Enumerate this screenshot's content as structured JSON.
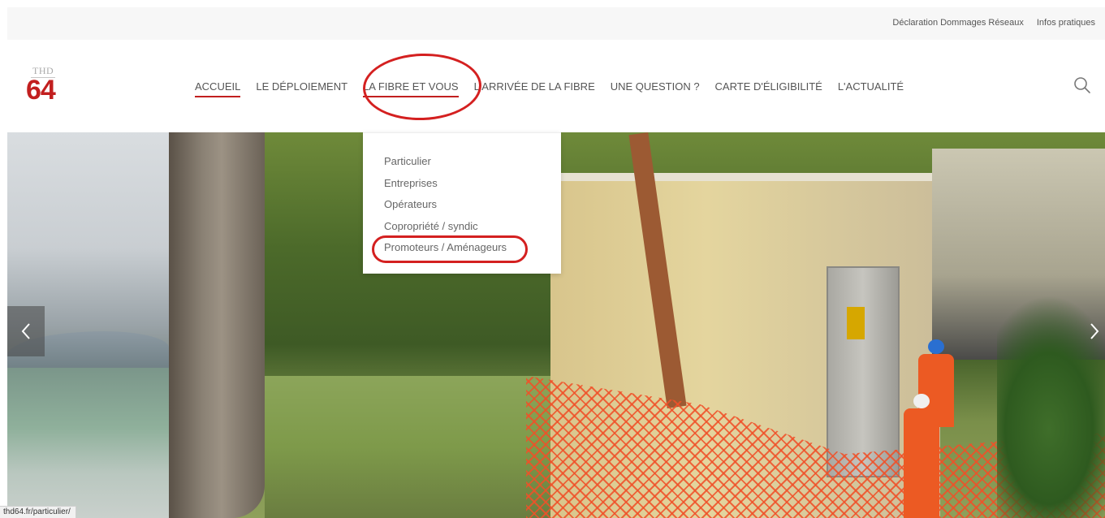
{
  "topbar": {
    "links": [
      "Déclaration Dommages Réseaux",
      "Infos pratiques"
    ]
  },
  "logo": {
    "small_text": "THD",
    "big_text": "64"
  },
  "nav": {
    "items": [
      "ACCUEIL",
      "LE DÉPLOIEMENT",
      "LA FIBRE ET VOUS",
      "L'ARRIVÉE DE LA FIBRE",
      "UNE QUESTION ?",
      "CARTE D'ÉLIGIBILITÉ",
      "L'ACTUALITÉ"
    ],
    "active": "ACCUEIL",
    "hovered": "LA FIBRE ET VOUS"
  },
  "dropdown": {
    "items": [
      "Particulier",
      "Entreprises",
      "Opérateurs",
      "Copropriété / syndic",
      "Promoteurs / Aménageurs"
    ]
  },
  "status_bar": {
    "url": "thd64.fr/particulier/"
  },
  "colors": {
    "accent": "#c21f1f",
    "annotation": "#d42020"
  }
}
